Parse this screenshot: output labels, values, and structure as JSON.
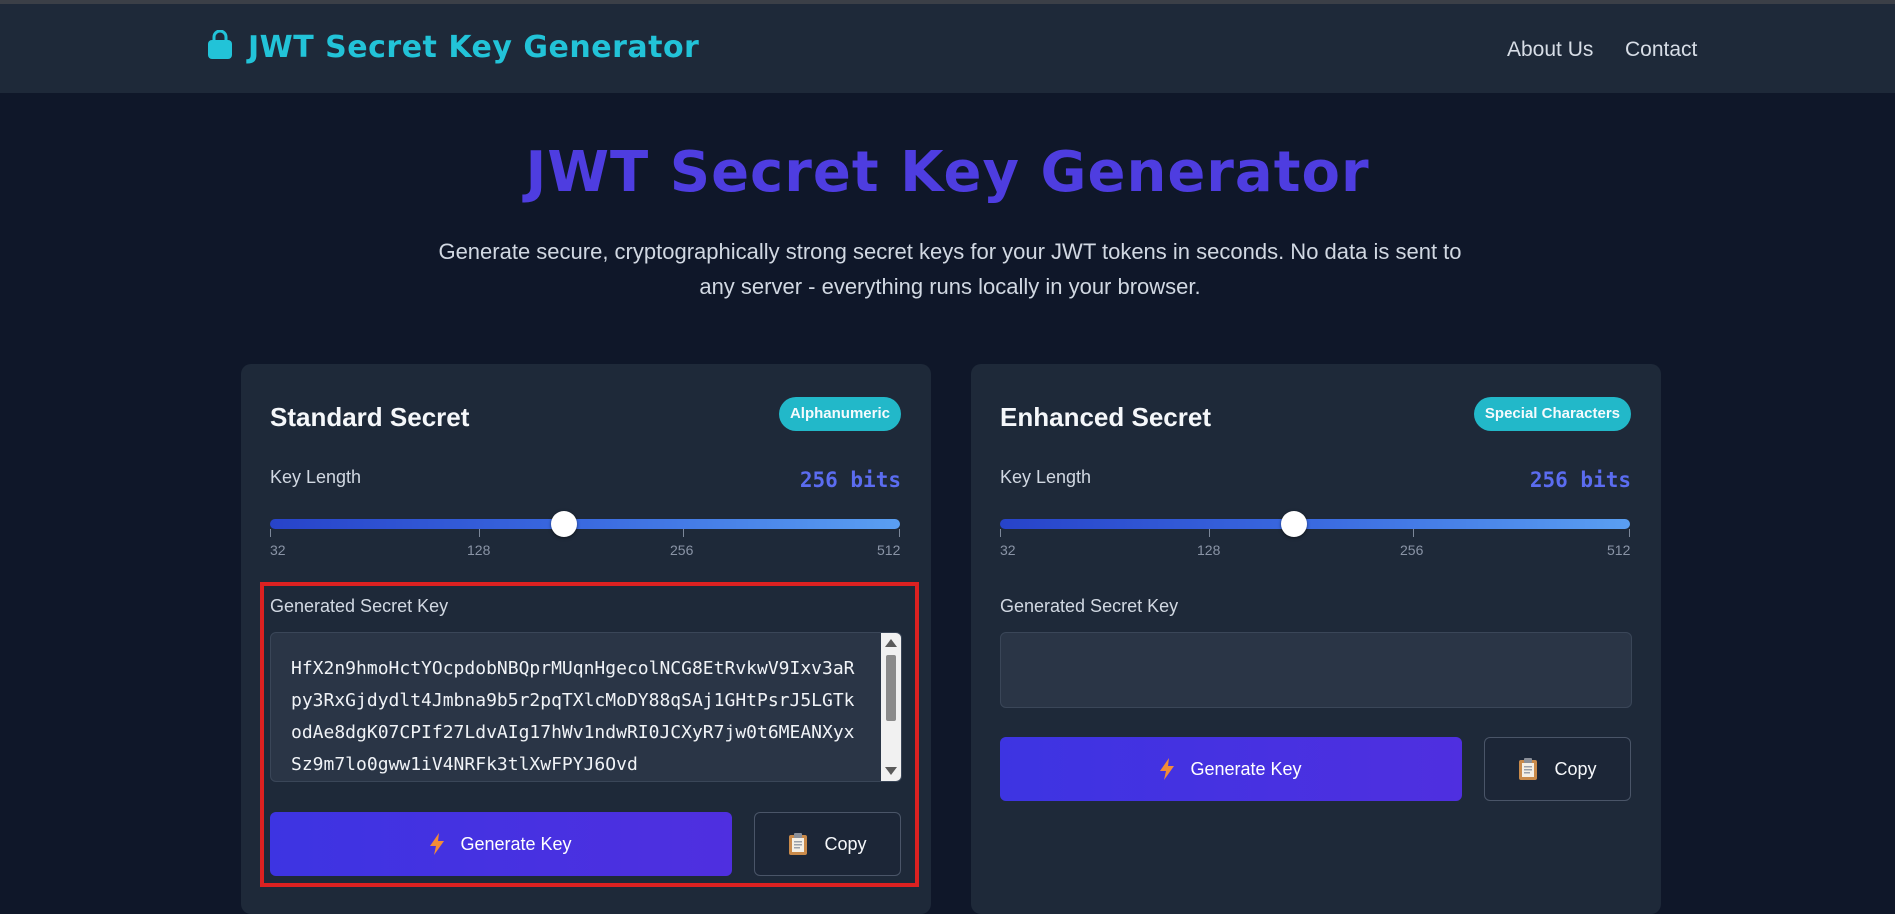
{
  "navbar": {
    "brand": "JWT Secret Key Generator",
    "links": [
      "About Us",
      "Contact"
    ]
  },
  "hero": {
    "title": "JWT Secret Key Generator",
    "subtitle": "Generate secure, cryptographically strong secret keys for your JWT tokens in seconds. No data is sent to any server - everything runs locally in your browser."
  },
  "standard": {
    "title": "Standard Secret",
    "badge": "Alphanumeric",
    "key_length_label": "Key Length",
    "bits": "256 bits",
    "slider_value_bits": 256,
    "ticks": [
      "32",
      "128",
      "256",
      "512"
    ],
    "generated_label": "Generated Secret Key",
    "key_value": "HfX2n9hmoHctYOcpdobNBQprMUqnHgecolNCG8EtRvkwV9Ixv3aRpy3RxGjdydlt4Jmbna9b5r2pqTXlcMoDY88qSAj1GHtPsrJ5LGTkodAe8dgK07CPIf27LdvAIg17hWv1ndwRI0JCXyR7jw0t6MEANXyxSz9m7lo0gww1iV4NRFk3tlXwFPYJ6Ovd",
    "generate_label": "Generate Key",
    "copy_label": "Copy"
  },
  "enhanced": {
    "title": "Enhanced Secret",
    "badge": "Special Characters",
    "key_length_label": "Key Length",
    "bits": "256 bits",
    "slider_value_bits": 256,
    "ticks": [
      "32",
      "128",
      "256",
      "512"
    ],
    "generated_label": "Generated Secret Key",
    "key_value": "",
    "generate_label": "Generate Key",
    "copy_label": "Copy"
  },
  "colors": {
    "accent": "#22c3d8",
    "hero": "#4e3de0",
    "button": "#3d34e2",
    "highlight": "#dc2121"
  }
}
